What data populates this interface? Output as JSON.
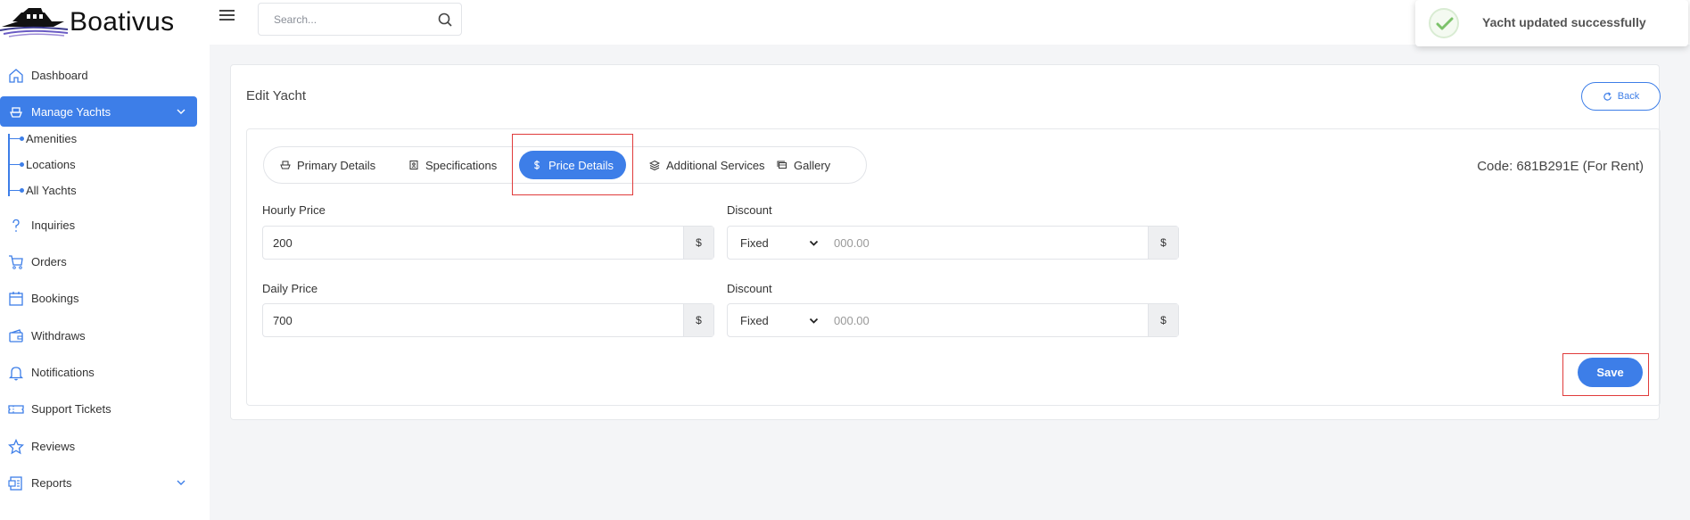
{
  "brand": {
    "name": "Boativus"
  },
  "search": {
    "placeholder": "Search..."
  },
  "toast": {
    "message": "Yacht updated successfully",
    "color": "#7cc26a"
  },
  "sidebar": {
    "items": [
      {
        "label": "Dashboard",
        "icon": "home-icon"
      },
      {
        "label": "Manage Yachts",
        "icon": "yacht-icon",
        "active": true
      },
      {
        "label": "Inquiries",
        "icon": "question-icon"
      },
      {
        "label": "Orders",
        "icon": "cart-icon"
      },
      {
        "label": "Bookings",
        "icon": "calendar-icon"
      },
      {
        "label": "Withdraws",
        "icon": "wallet-icon"
      },
      {
        "label": "Notifications",
        "icon": "bell-icon"
      },
      {
        "label": "Support Tickets",
        "icon": "ticket-icon"
      },
      {
        "label": "Reviews",
        "icon": "star-icon"
      },
      {
        "label": "Reports",
        "icon": "report-icon"
      }
    ],
    "submenu": [
      {
        "label": "Amenities"
      },
      {
        "label": "Locations"
      },
      {
        "label": "All Yachts"
      }
    ]
  },
  "page": {
    "title": "Edit Yacht",
    "back_label": "Back",
    "code": "Code: 681B291E (For Rent)"
  },
  "tabs": [
    {
      "label": "Primary Details",
      "icon": "boat-icon"
    },
    {
      "label": "Specifications",
      "icon": "spec-icon"
    },
    {
      "label": "Price Details",
      "icon": "dollar-icon",
      "active": true
    },
    {
      "label": "Additional Services",
      "icon": "layers-icon"
    },
    {
      "label": "Gallery",
      "icon": "gallery-icon"
    }
  ],
  "form": {
    "hourly_label": "Hourly Price",
    "hourly_value": "200",
    "hourly_addon": "$",
    "discount1_label": "Discount",
    "discount1_type": "Fixed",
    "discount1_placeholder": "000.00",
    "discount1_addon": "$",
    "daily_label": "Daily Price",
    "daily_value": "700",
    "daily_addon": "$",
    "discount2_label": "Discount",
    "discount2_type": "Fixed",
    "discount2_placeholder": "000.00",
    "discount2_addon": "$",
    "save_label": "Save"
  },
  "colors": {
    "accent": "#3d7ee8",
    "highlight": "#e03b3b"
  }
}
